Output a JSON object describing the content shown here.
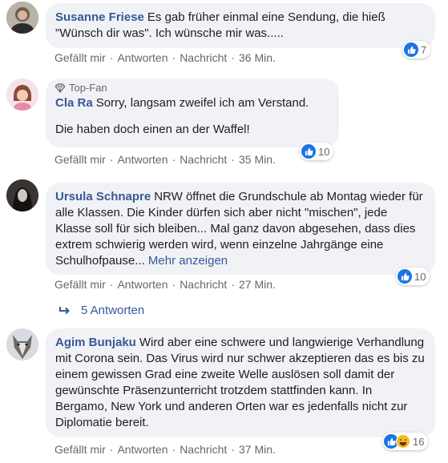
{
  "comments": [
    {
      "author": "Susanne Friese",
      "text": "Es gab früher einmal eine Sendung, die hieß \"Wünsch dir was\". Ich wünsche mir was.....",
      "like_label": "Gefällt mir",
      "reply_label": "Antworten",
      "message_label": "Nachricht",
      "time": "36 Min.",
      "reaction_count": "7"
    },
    {
      "badge_label": "Top-Fan",
      "author": "Cla Ra",
      "text": "Sorry, langsam zweifel ich am Verstand.",
      "text2": "Die haben doch einen an der Waffel!",
      "like_label": "Gefällt mir",
      "reply_label": "Antworten",
      "message_label": "Nachricht",
      "time": "35 Min.",
      "reaction_count": "10"
    },
    {
      "author": "Ursula Schnapre",
      "text": "NRW öffnet die Grundschule ab Montag wieder für alle Klassen. Die Kinder dürfen sich aber nicht \"mischen\", jede Klasse soll für sich bleiben... Mal ganz davon abgesehen, dass dies extrem schwierig werden wird, wenn einzelne Jahrgänge eine Schulhofpause...",
      "more_label": "Mehr anzeigen",
      "like_label": "Gefällt mir",
      "reply_label": "Antworten",
      "message_label": "Nachricht",
      "time": "27 Min.",
      "reaction_count": "10",
      "replies_label": "5 Antworten"
    },
    {
      "author": "Agim Bunjaku",
      "text": "Wird aber eine schwere und langwierige Verhandlung mit Corona sein. Das Virus wird nur schwer akzeptieren das es bis zu einem gewissen Grad eine zweite Welle auslösen soll damit der gewünschte Präsenzunterricht trotzdem stattfinden kann. In Bergamo, New York und anderen Orten war es jedenfalls nicht zur Diplomatie bereit.",
      "like_label": "Gefällt mir",
      "reply_label": "Antworten",
      "message_label": "Nachricht",
      "time": "37 Min.",
      "reaction_count": "16"
    }
  ],
  "separator": "·",
  "colors": {
    "link": "#385898",
    "bubble": "#f0f2f5",
    "like": "#1b74e4",
    "haha": "#f7b928",
    "meta": "#65676b"
  },
  "icons": {
    "like": "thumbs-up-icon",
    "haha": "haha-emoji-icon",
    "topfan": "diamond-icon",
    "reply_arrow": "reply-arrow-icon"
  }
}
